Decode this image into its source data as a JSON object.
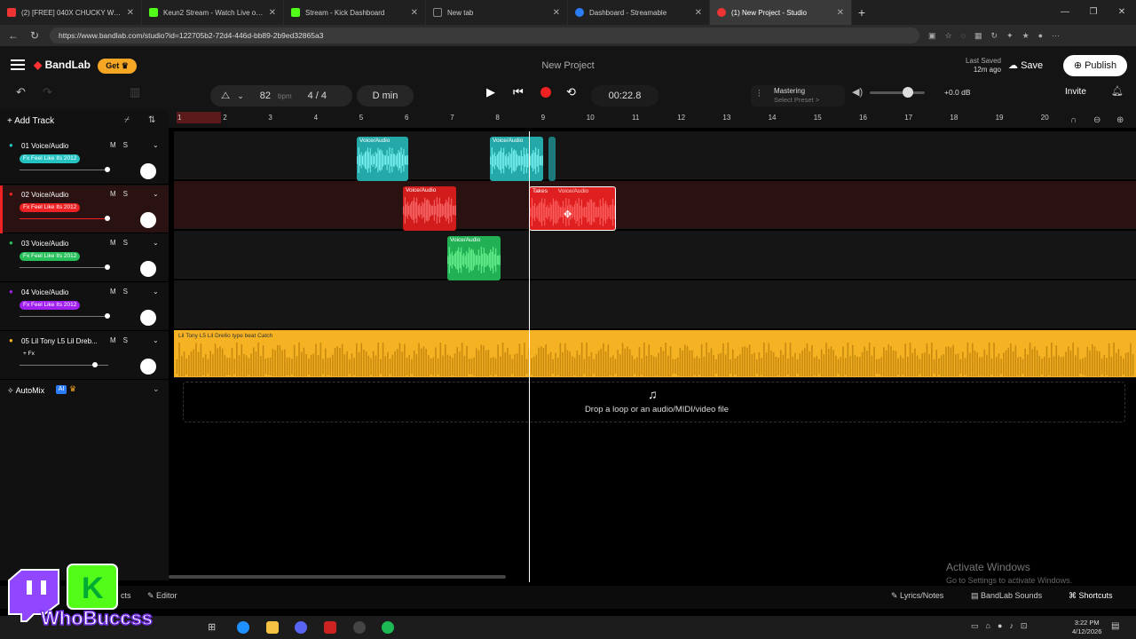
{
  "browser": {
    "tabs": [
      {
        "title": "(2) [FREE] 040X CHUCKY WACKE",
        "color": "#e33"
      },
      {
        "title": "Keun2 Stream - Watch Live on Kick",
        "color": "#53fc18"
      },
      {
        "title": "Stream - Kick Dashboard",
        "color": "#53fc18"
      },
      {
        "title": "New tab",
        "color": "#888"
      },
      {
        "title": "Dashboard - Streamable",
        "color": "#2a7cf7"
      },
      {
        "title": "(1) New Project - Studio",
        "color": "#e33"
      }
    ],
    "url": "https://www.bandlab.com/studio?id=122705b2-72d4-446d-bb89-2b9ed32865a3"
  },
  "app": {
    "logo": "BandLab",
    "get_label": "Get",
    "project_name": "New Project",
    "last_saved_label": "Last Saved",
    "last_saved_time": "12m ago",
    "save_label": "Save",
    "publish_label": "Publish"
  },
  "transport": {
    "bpm": "82",
    "bpm_unit": "bpm",
    "time_sig": "4 / 4",
    "key": "D min",
    "time": "00:22.8",
    "mastering_label": "Mastering",
    "mastering_preset": "Select Preset >",
    "db": "+0.0 dB",
    "invite_label": "Invite"
  },
  "tracks": {
    "add_label": "Add Track",
    "list": [
      {
        "name": "01  Voice/Audio",
        "fx": "Fx Feel Like Its 2012",
        "color": "#25c2c2",
        "m": "M",
        "s": "S"
      },
      {
        "name": "02  Voice/Audio",
        "fx": "Fx Feel Like Its 2012",
        "color": "#e22",
        "m": "M",
        "s": "S"
      },
      {
        "name": "03  Voice/Audio",
        "fx": "Fx Feel Like Its 2012",
        "color": "#27c05a",
        "m": "M",
        "s": "S"
      },
      {
        "name": "04  Voice/Audio",
        "fx": "Fx Feel Like Its 2012",
        "color": "#a020f0",
        "m": "M",
        "s": "S"
      },
      {
        "name": "05  Lil Tony L5 Lil Dreb...",
        "fx": "+ Fx",
        "color": "#f5b324",
        "m": "M",
        "s": "S"
      }
    ],
    "automix_label": "AutoMix",
    "ai_badge": "AI"
  },
  "ruler": [
    "1",
    "2",
    "3",
    "4",
    "5",
    "6",
    "7",
    "8",
    "9",
    "10",
    "11",
    "12",
    "13",
    "14",
    "15",
    "16",
    "17",
    "18",
    "19",
    "20"
  ],
  "clips": {
    "voice_label": "Voice/Audio",
    "takes_label": "Takes",
    "takes_sub": "Voice/Audio",
    "beat_label": "Lil Tony L5 Lil Dre6o type beat Catch"
  },
  "drop_text": "Drop a loop or an audio/MIDI/video file",
  "bottom": {
    "editor_label": "Editor",
    "lyrics_label": "Lyrics/Notes",
    "sounds_label": "BandLab Sounds",
    "shortcuts_label": "Shortcuts",
    "fragment": "cts"
  },
  "windows": {
    "activate_title": "Activate Windows",
    "activate_sub": "Go to Settings to activate Windows.",
    "clock_time": "3:22 PM",
    "clock_date": "4/12/2026"
  },
  "overlay": {
    "text": "WhoBuccss"
  }
}
